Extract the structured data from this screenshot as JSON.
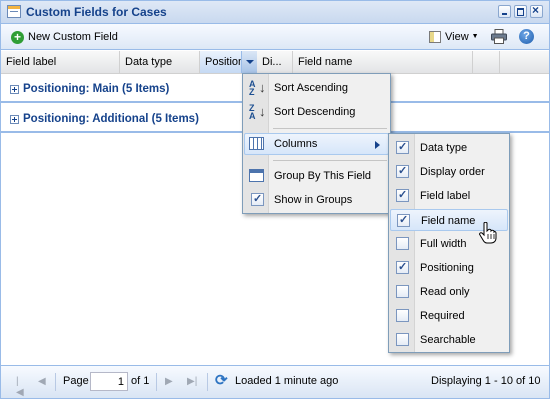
{
  "window": {
    "title": "Custom Fields for Cases"
  },
  "toolbar": {
    "new_label": "New Custom Field",
    "view_label": "View"
  },
  "columns": [
    {
      "label": "Field label"
    },
    {
      "label": "Data type"
    },
    {
      "label": "Position"
    },
    {
      "label": "Di..."
    },
    {
      "label": "Field name"
    }
  ],
  "groups": [
    {
      "label": "Positioning: Main (5 Items)"
    },
    {
      "label": "Positioning: Additional (5 Items)"
    }
  ],
  "column_menu": {
    "sort_asc": "Sort Ascending",
    "sort_desc": "Sort Descending",
    "columns": "Columns",
    "group_by": "Group By This Field",
    "show_in_groups": "Show in Groups",
    "show_in_groups_checked": true
  },
  "columns_submenu": {
    "items": [
      {
        "label": "Data type",
        "checked": true
      },
      {
        "label": "Display order",
        "checked": true
      },
      {
        "label": "Field label",
        "checked": true
      },
      {
        "label": "Field name",
        "checked": true
      },
      {
        "label": "Full width",
        "checked": false
      },
      {
        "label": "Positioning",
        "checked": true
      },
      {
        "label": "Read only",
        "checked": false
      },
      {
        "label": "Required",
        "checked": false
      },
      {
        "label": "Searchable",
        "checked": false
      }
    ]
  },
  "paging": {
    "page_label": "Page",
    "page_value": "1",
    "of_label": "of 1",
    "status": "Loaded 1 minute ago",
    "displaying": "Displaying 1 - 10 of 10"
  }
}
